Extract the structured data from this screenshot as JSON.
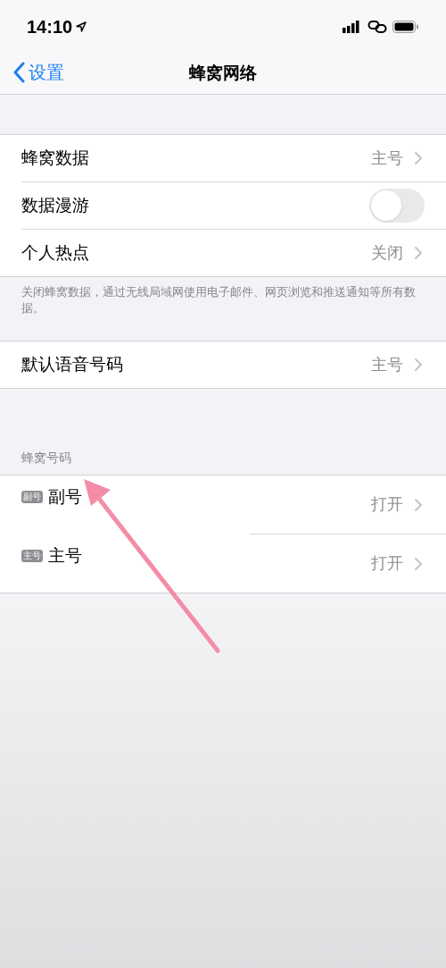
{
  "status_bar": {
    "time": "14:10"
  },
  "nav": {
    "back_label": "设置",
    "title": "蜂窝网络"
  },
  "groups": [
    {
      "rows": [
        {
          "kind": "value",
          "label": "蜂窝数据",
          "value": "主号"
        },
        {
          "kind": "toggle",
          "label": "数据漫游",
          "on": false
        },
        {
          "kind": "value",
          "label": "个人热点",
          "value": "关闭"
        }
      ],
      "footer": "关闭蜂窝数据，通过无线局域网使用电子邮件、网页浏览和推送通知等所有数据。"
    },
    {
      "rows": [
        {
          "kind": "value",
          "label": "默认语音号码",
          "value": "主号"
        }
      ]
    },
    {
      "header": "蜂窝号码",
      "rows": [
        {
          "kind": "sim",
          "badge": "副号",
          "label": "副号",
          "value": "打开"
        },
        {
          "kind": "sim",
          "badge": "主号",
          "label": "主号",
          "value": "打开"
        }
      ]
    }
  ]
}
